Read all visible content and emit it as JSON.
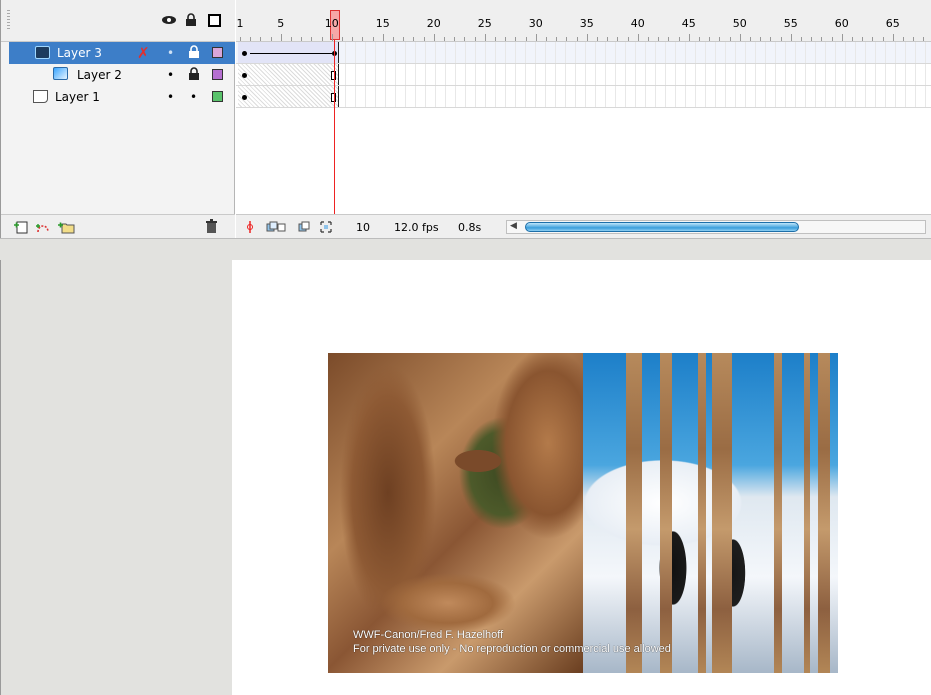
{
  "timeline": {
    "layers": [
      {
        "name": "Layer 3",
        "selected": true,
        "swatch": "#d9a6d9"
      },
      {
        "name": "Layer 2",
        "selected": false,
        "swatch": "#b56fd0"
      },
      {
        "name": "Layer 1",
        "selected": false,
        "swatch": "#59c26b"
      }
    ],
    "header_icons": [
      "eye-icon",
      "lock-icon",
      "outline-icon"
    ],
    "ruler_labels": [
      "1",
      "5",
      "10",
      "15",
      "20",
      "25",
      "30",
      "35",
      "40",
      "45",
      "50",
      "55",
      "60",
      "65"
    ],
    "current_frame": "10",
    "frame_rate": "12.0 fps",
    "elapsed_time": "0.8s",
    "footer_icons": [
      "insert-layer-icon",
      "add-motion-guide-icon",
      "insert-layer-folder-icon",
      "delete-layer-icon"
    ]
  },
  "stage": {
    "credit_line_1": "WWF-Canon/Fred F. Hazelhoff",
    "credit_line_2": "For private use only - No reproduction or commercial use allowed"
  },
  "colors": {
    "selection": "#3d7ec8",
    "playhead": "#e22222",
    "scrollbar": "#3c9edb"
  }
}
